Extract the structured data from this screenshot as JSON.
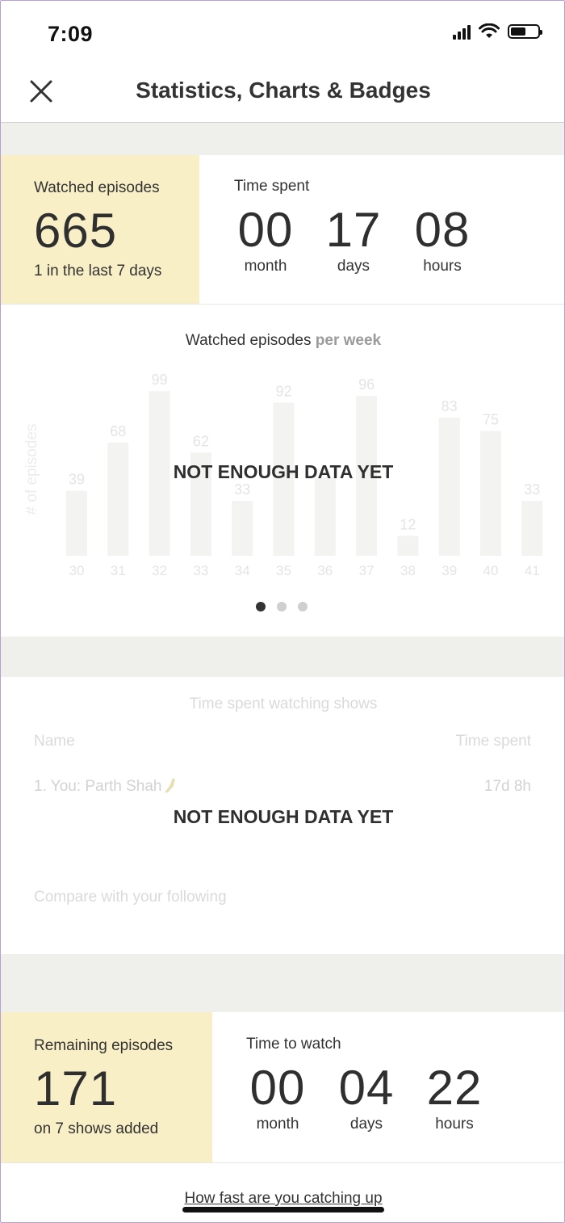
{
  "status_bar": {
    "time": "7:09",
    "battery_level": 0.55
  },
  "header": {
    "title": "Statistics, Charts & Badges",
    "close_icon": "close-icon"
  },
  "watched": {
    "label": "Watched episodes",
    "value": "665",
    "sub": "1 in the last 7 days",
    "time_label": "Time spent",
    "time": [
      {
        "value": "00",
        "unit": "month"
      },
      {
        "value": "17",
        "unit": "days"
      },
      {
        "value": "08",
        "unit": "hours"
      }
    ]
  },
  "chart": {
    "title_main": "Watched episodes",
    "title_muted": "per week",
    "overlay": "NOT ENOUGH DATA YET",
    "active_page": 1,
    "pages": 3
  },
  "chart_data": {
    "type": "bar",
    "categories": [
      "30",
      "31",
      "32",
      "33",
      "34",
      "35",
      "36",
      "37",
      "38",
      "39",
      "40",
      "41"
    ],
    "values": [
      39,
      68,
      99,
      62,
      33,
      92,
      47,
      96,
      12,
      83,
      75,
      33
    ],
    "data_labels": [
      "39",
      "68",
      "99",
      "62",
      "33",
      "92",
      "",
      "96",
      "12",
      "83",
      "75",
      "33"
    ],
    "ylabel": "# of episodes",
    "ylim": [
      0,
      100
    ],
    "grid": false
  },
  "time_table": {
    "title": "Time spent watching shows",
    "col_name": "Name",
    "col_time": "Time spent",
    "row_name": "1. You: Parth Shah",
    "row_time": "17d 8h",
    "overlay": "NOT ENOUGH DATA YET",
    "compare": "Compare with your following"
  },
  "remaining": {
    "label": "Remaining episodes",
    "value": "171",
    "sub": "on 7 shows added",
    "time_label": "Time to watch",
    "time": [
      {
        "value": "00",
        "unit": "month"
      },
      {
        "value": "04",
        "unit": "days"
      },
      {
        "value": "22",
        "unit": "hours"
      }
    ]
  },
  "footer": {
    "link": "How fast are you catching up"
  }
}
